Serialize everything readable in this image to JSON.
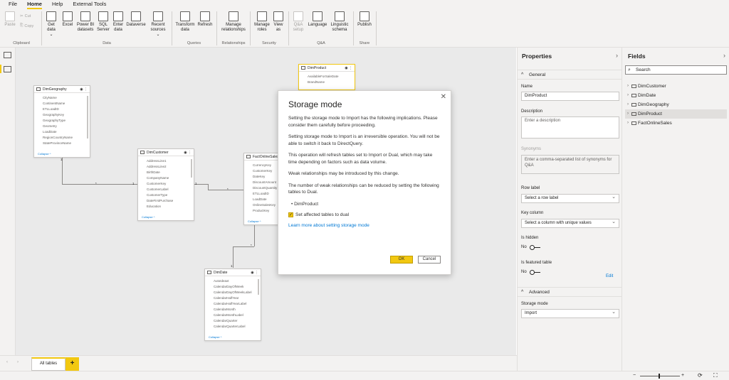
{
  "menu": {
    "items": [
      "File",
      "Home",
      "Help",
      "External Tools"
    ],
    "active": "Home"
  },
  "ribbon": {
    "clipboard": {
      "paste": "Paste",
      "cut": "Cut",
      "copy": "Copy",
      "group": "Clipboard"
    },
    "data": {
      "get_data": "Get data",
      "get_data_sub": "⌄",
      "excel": "Excel",
      "power_bi": "Power BI datasets",
      "sql": "SQL Server",
      "enter_data": "Enter data",
      "dataverse": "Dataverse",
      "recent": "Recent sources",
      "recent_sub": "⌄",
      "group": "Data"
    },
    "queries": {
      "transform": "Transform data",
      "refresh": "Refresh",
      "group": "Queries"
    },
    "relationships": {
      "manage": "Manage relationships",
      "group": "Relationships"
    },
    "security": {
      "manage_roles": "Manage roles",
      "view_as": "View as",
      "group": "Security"
    },
    "qa": {
      "qa_setup": "Q&A setup",
      "language": "Language",
      "linguistic": "Linguistic schema",
      "group": "Q&A"
    },
    "share": {
      "publish": "Publish",
      "group": "Share"
    }
  },
  "canvas": {
    "tables": {
      "dimgeography": {
        "name": "DimGeography",
        "fields": [
          "CityName",
          "ContinentName",
          "ETLLoadID",
          "GeographyKey",
          "GeographyType",
          "Geometry",
          "LoadDate",
          "RegionCountryName",
          "StateProvinceName"
        ],
        "collapse": "Collapse ^"
      },
      "dimcustomer": {
        "name": "DimCustomer",
        "fields": [
          "AddressLine1",
          "AddressLine2",
          "BirthDate",
          "CompanyName",
          "CustomerKey",
          "CustomerLabel",
          "CustomerType",
          "DateFirstPurchase",
          "Education"
        ],
        "collapse": "Collapse ^"
      },
      "factonlinesales": {
        "name": "FactOnlineSales",
        "fields": [
          "CurrencyKey",
          "CustomerKey",
          "DateKey",
          "DiscountAmount",
          "DiscountQuantity",
          "ETLLoadID",
          "LoadDate",
          "OnlineSalesKey",
          "ProductKey"
        ],
        "collapse": "Collapse ^"
      },
      "dimproduct": {
        "name": "DimProduct",
        "fields": [
          "AvailableForSaleDate",
          "BrandName"
        ]
      },
      "dimdate": {
        "name": "DimDate",
        "fields": [
          "AutoIdeaxt",
          "CalendarDayOfWeek",
          "CalendarDayOfWeekLabel",
          "CalendarHalfYear",
          "CalendarHalfYearLabel",
          "CalendarMonth",
          "CalendarMonthLabel",
          "CalendarQuarter",
          "CalendarQuarterLabel"
        ],
        "collapse": "Collapse ^"
      }
    },
    "cardinality": {
      "one": "1",
      "many": "*"
    }
  },
  "modal": {
    "title": "Storage mode",
    "p1": "Setting the storage mode to Import has the following implications. Please consider them carefully before proceeding.",
    "p2": "Setting storage mode to Import is an irreversible operation.  You will not be able to switch it back to DirectQuery.",
    "p3": "This operation will refresh tables set to Import or Dual, which may take time depending on factors such as data volume.",
    "p4": "Weak relationships may be introduced by this change.",
    "p5": "The number of weak relationships can be reduced by setting the following tables to Dual.",
    "table_item": "DimProduct",
    "checkbox_label": "Set affected tables to dual",
    "link": "Learn more about setting storage mode",
    "ok": "OK",
    "cancel": "Cancel"
  },
  "bottom": {
    "tab": "All tables",
    "add": "+"
  },
  "properties": {
    "title": "Properties",
    "general": "General",
    "name_label": "Name",
    "name_value": "DimProduct",
    "desc_label": "Description",
    "desc_placeholder": "Enter a description",
    "synonyms_label": "Synonyms",
    "synonyms_placeholder": "Enter a comma-separated list of synonyms for Q&A",
    "row_label": "Row label",
    "row_label_placeholder": "Select a row label",
    "key_column": "Key column",
    "key_column_placeholder": "Select a column with unique values",
    "is_hidden": "Is hidden",
    "is_hidden_value": "No",
    "is_featured": "Is featured table",
    "is_featured_value": "No",
    "edit": "Edit",
    "advanced": "Advanced",
    "storage_mode": "Storage mode",
    "storage_mode_value": "Import"
  },
  "fields": {
    "title": "Fields",
    "search": "Search",
    "items": [
      "DimCustomer",
      "DimDate",
      "DimGeography",
      "DimProduct",
      "FactOnlineSales"
    ],
    "selected": "DimProduct"
  },
  "colors": {
    "accent": "#f2c811",
    "link": "#0078d4"
  }
}
